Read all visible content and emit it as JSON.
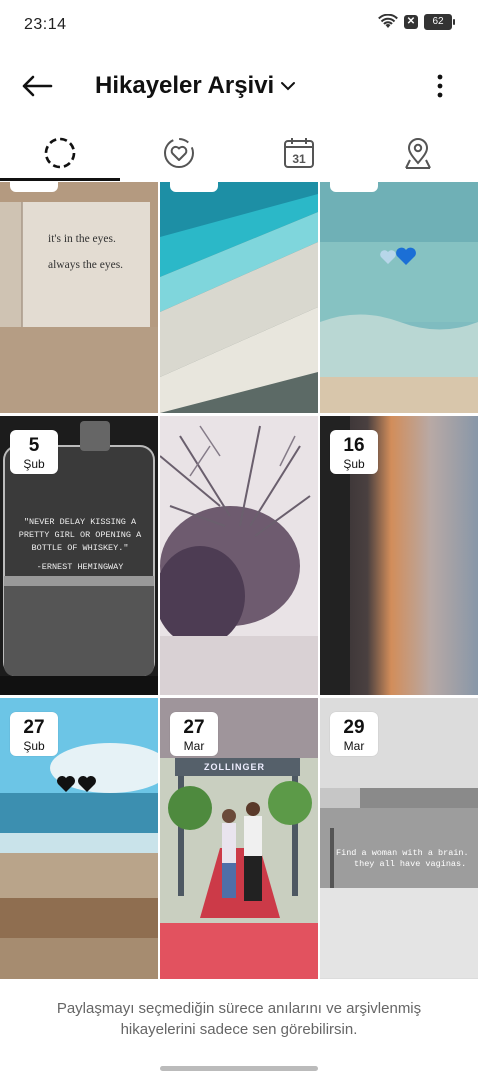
{
  "status_bar": {
    "time": "23:14",
    "battery": "62",
    "icons": [
      "wifi-icon",
      "notification-x-icon",
      "battery-icon"
    ]
  },
  "header": {
    "title": "Hikayeler Arşivi",
    "icons": [
      "back-arrow-icon",
      "chevron-down-icon",
      "more-vertical-icon"
    ]
  },
  "tabs": [
    {
      "name": "stories",
      "icon": "dashed-circle-icon",
      "active": true
    },
    {
      "name": "highlights",
      "icon": "heart-circle-icon",
      "active": false
    },
    {
      "name": "calendar",
      "icon": "calendar-icon",
      "calendar_day": "31",
      "active": false
    },
    {
      "name": "map",
      "icon": "location-pin-icon",
      "active": false
    }
  ],
  "grid": [
    {
      "name": "story-book",
      "photo_text": [
        "it's in the eyes.",
        "always the eyes."
      ]
    },
    {
      "name": "story-beach-tilted"
    },
    {
      "name": "story-sea-hearts",
      "sticker": "heart-icons"
    },
    {
      "name": "story-whiskey-glass",
      "day": "5",
      "month": "Şub",
      "photo_text": [
        "\"NEVER DELAY KISSING A",
        "PRETTY GIRL OR OPENING A",
        "BOTTLE OF WHISKEY.\"",
        "-ERNEST HEMINGWAY"
      ]
    },
    {
      "name": "story-branches"
    },
    {
      "name": "story-sunset",
      "day": "16",
      "month": "Şub"
    },
    {
      "name": "story-beach-hearts",
      "day": "27",
      "month": "Şub"
    },
    {
      "name": "story-couple",
      "day": "27",
      "month": "Mar",
      "photo_text": [
        "ZOLLINGER"
      ]
    },
    {
      "name": "story-wall-graffiti",
      "day": "29",
      "month": "Mar",
      "photo_text": [
        "Find a woman with a brain.",
        "they all have vaginas."
      ]
    }
  ],
  "footer": {
    "note": "Paylaşmayı seçmediğin sürece anılarını ve arşivlenmiş hikayelerini sadece sen görebilirsin."
  }
}
